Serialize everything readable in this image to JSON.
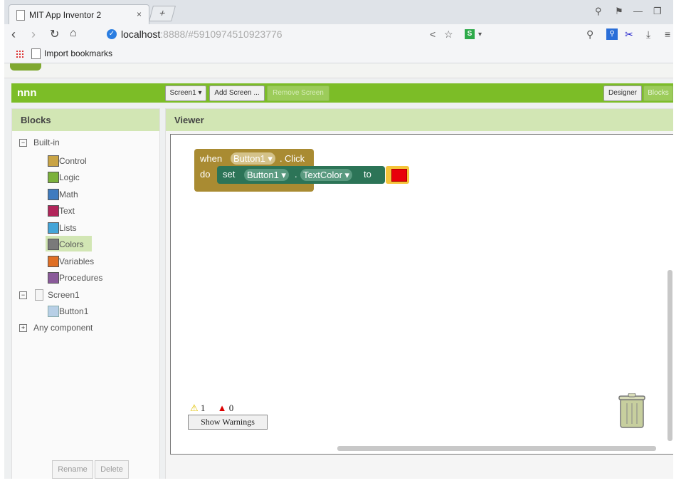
{
  "browser": {
    "tab_title": "MIT App Inventor 2",
    "tab_close": "×",
    "new_tab": "+",
    "url_host": "localhost",
    "url_path": ":8888/#5910974510923776",
    "extension_badge": "S",
    "bookmarks_label": "Import bookmarks"
  },
  "app": {
    "project_name": "nnn",
    "screen_select": "Screen1 ▾",
    "add_screen": "Add Screen ...",
    "remove_screen": "Remove Screen",
    "designer": "Designer",
    "blocks_btn": "Blocks"
  },
  "blocks_panel": {
    "title": "Blocks",
    "builtin": "Built-in",
    "items": [
      {
        "label": "Control",
        "color": "#c9a445"
      },
      {
        "label": "Logic",
        "color": "#7bb13b"
      },
      {
        "label": "Math",
        "color": "#3f7bbf"
      },
      {
        "label": "Text",
        "color": "#b1255a"
      },
      {
        "label": "Lists",
        "color": "#44a5d8"
      },
      {
        "label": "Colors",
        "color": "#7a7a7a"
      },
      {
        "label": "Variables",
        "color": "#e06f25"
      },
      {
        "label": "Procedures",
        "color": "#8a5a9a"
      }
    ],
    "screen": "Screen1",
    "button": "Button1",
    "any_component": "Any component",
    "rename": "Rename",
    "delete": "Delete"
  },
  "viewer": {
    "title": "Viewer",
    "event_when": "when",
    "event_component": "Button1 ▾",
    "event_dot": ".",
    "event_name": "Click",
    "event_do": "do",
    "set": "set",
    "set_component": "Button1 ▾",
    "set_dot": ".",
    "set_property": "TextColor ▾",
    "set_to": "to",
    "warning_count": "1",
    "error_count": "0",
    "show_warnings": "Show Warnings"
  }
}
